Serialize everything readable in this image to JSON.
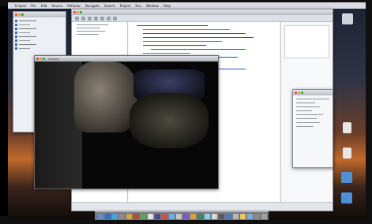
{
  "menubar": {
    "items": [
      "Eclipse",
      "File",
      "Edit",
      "Source",
      "Refactor",
      "Navigate",
      "Search",
      "Project",
      "Run",
      "Window",
      "Help"
    ]
  },
  "camera_window": {
    "title": "Camera"
  },
  "desktop_icons": [
    {
      "icon": "drive-icon",
      "color": "#cfd4dc"
    },
    {
      "icon": "document-icon",
      "color": "#e7e7e7"
    },
    {
      "icon": "document-icon",
      "color": "#e7e7e7"
    },
    {
      "icon": "folder-icon",
      "color": "#4f8fd8"
    },
    {
      "icon": "folder-icon",
      "color": "#4f8fd8"
    }
  ],
  "dock": {
    "app_colors": [
      "#5b8cd8",
      "#2f6fc8",
      "#3fa7e0",
      "#8c8c8c",
      "#d8a43a",
      "#b04a3a",
      "#5aa75a",
      "#e2e2e2",
      "#4a4a8a",
      "#d04a4a",
      "#6ab0e8",
      "#c8c8c8",
      "#7a5ad0",
      "#e29a3a",
      "#3a8a5a",
      "#8ad0e8",
      "#d8d8d8",
      "#5a5a5a",
      "#4a7ac8",
      "#b8b8b8",
      "#e8c85a",
      "#7ab0d8",
      "#888888",
      "#a0a0a0"
    ]
  }
}
